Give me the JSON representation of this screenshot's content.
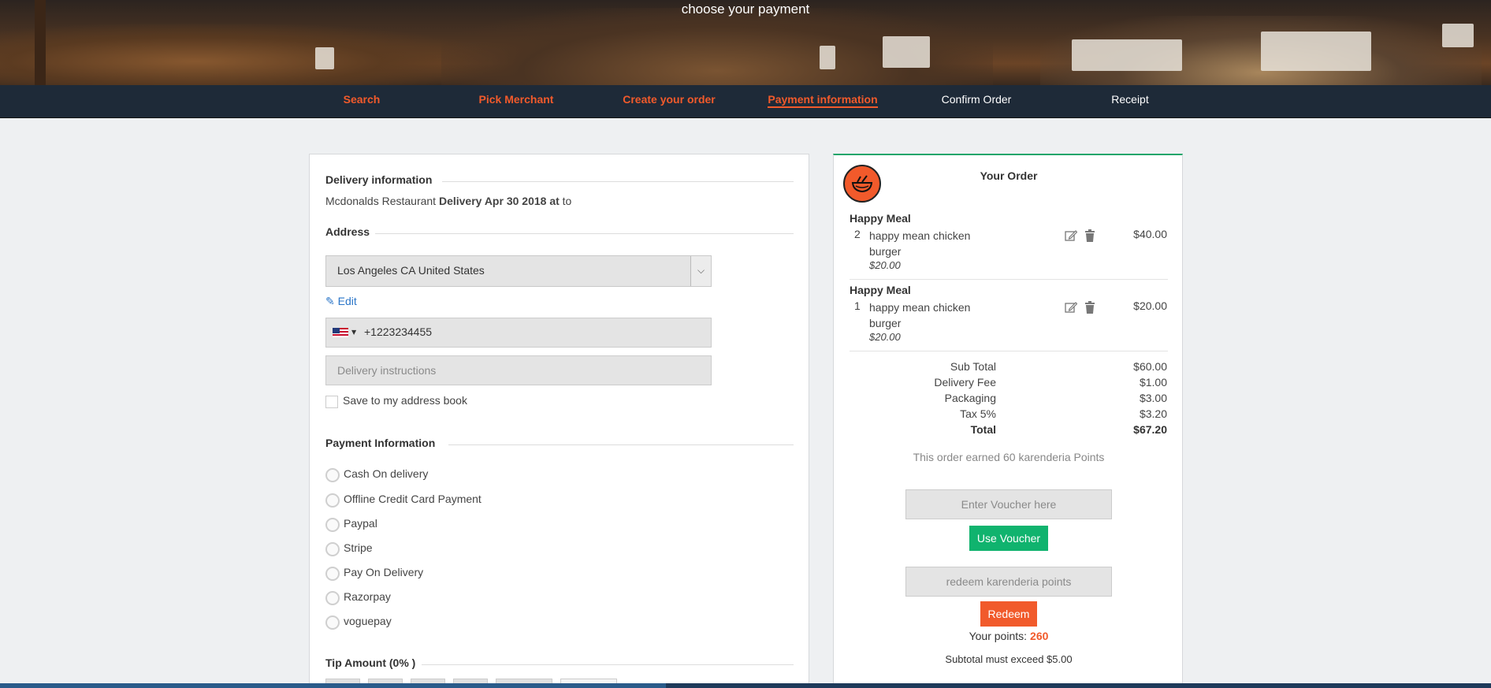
{
  "header": {
    "title": "choose your payment"
  },
  "steps": [
    {
      "label": "Search",
      "state": "done"
    },
    {
      "label": "Pick Merchant",
      "state": "done"
    },
    {
      "label": "Create your order",
      "state": "done"
    },
    {
      "label": "Payment information",
      "state": "active"
    },
    {
      "label": "Confirm Order",
      "state": "pending"
    },
    {
      "label": "Receipt",
      "state": "pending"
    }
  ],
  "delivery": {
    "section_title": "Delivery information",
    "merchant": "Mcdonalds Restaurant",
    "delivery_text": "Delivery Apr 30 2018 at",
    "suffix": "to"
  },
  "address": {
    "section_title": "Address",
    "selected": "Los Angeles CA United States",
    "edit_label": "Edit",
    "phone": "+1223234455",
    "instructions_placeholder": "Delivery instructions",
    "save_label": "Save to my address book"
  },
  "payment": {
    "section_title": "Payment Information",
    "options": [
      "Cash On delivery",
      "Offline Credit Card Payment",
      "Paypal",
      "Stripe",
      "Pay On Delivery",
      "Razorpay",
      "voguepay"
    ]
  },
  "tip": {
    "section_title": "Tip Amount (0%  )"
  },
  "order": {
    "title": "Your Order",
    "items": [
      {
        "name": "Happy Meal",
        "qty": "2",
        "desc": "happy mean chicken burger",
        "unit_price": "$20.00",
        "total": "$40.00"
      },
      {
        "name": "Happy Meal",
        "qty": "1",
        "desc": "happy mean chicken burger",
        "unit_price": "$20.00",
        "total": "$20.00"
      }
    ],
    "summary": [
      {
        "label": "Sub Total",
        "value": "$60.00"
      },
      {
        "label": "Delivery Fee",
        "value": "$1.00"
      },
      {
        "label": "Packaging",
        "value": "$3.00"
      },
      {
        "label": "Tax 5%",
        "value": "$3.20"
      },
      {
        "label": "Total",
        "value": "$67.20"
      }
    ],
    "points_note": "This order earned 60 karenderia Points",
    "voucher_placeholder": "Enter Voucher here",
    "voucher_button": "Use Voucher",
    "redeem_placeholder": "redeem karenderia points",
    "redeem_button": "Redeem",
    "your_points_label": "Your points:",
    "your_points_value": "260",
    "min_note": "Subtotal must exceed $5.00"
  },
  "colors": {
    "accent": "#f15a2b",
    "green": "#10b36e",
    "nav": "#1e2a38",
    "link": "#2a75c8"
  }
}
